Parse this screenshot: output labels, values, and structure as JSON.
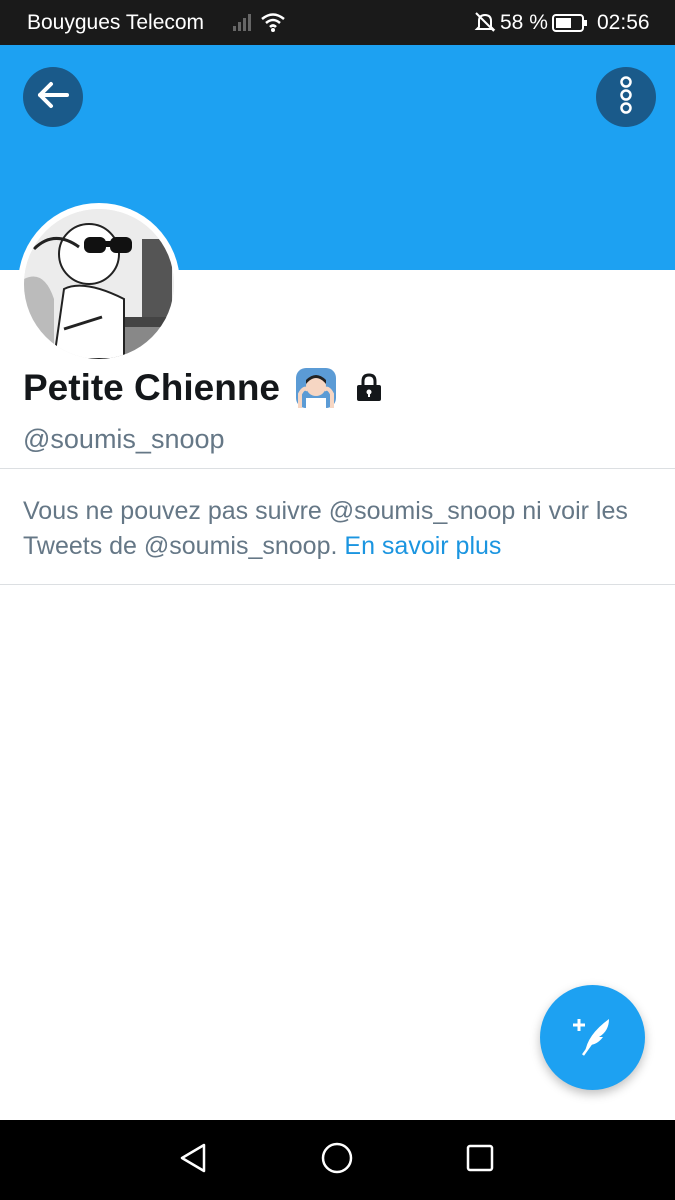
{
  "status_bar": {
    "carrier": "Bouygues Telecom",
    "battery_percent": "58 %",
    "time": "02:56",
    "icons": [
      "signal-icon",
      "wifi-icon",
      "bell-off-icon",
      "battery-icon"
    ]
  },
  "header": {
    "banner_color": "#1da1f2",
    "back_icon": "arrow-left-icon",
    "more_icon": "more-vertical-icon"
  },
  "profile": {
    "name": "Petite Chienne",
    "handle": "@soumis_snoop",
    "name_emoji": "person-gesturing-ok-emoji",
    "protected_icon": "lock-icon"
  },
  "notice": {
    "text": "Vous ne pouvez pas suivre @soumis_snoop ni voir les Tweets de @soumis_snoop.",
    "link_label": "En savoir plus",
    "link_color": "#1b95e0"
  },
  "fab": {
    "icon": "compose-tweet-icon",
    "color": "#1da1f2"
  },
  "nav_bar": {
    "icons": [
      "nav-back-icon",
      "nav-home-icon",
      "nav-recents-icon"
    ]
  }
}
